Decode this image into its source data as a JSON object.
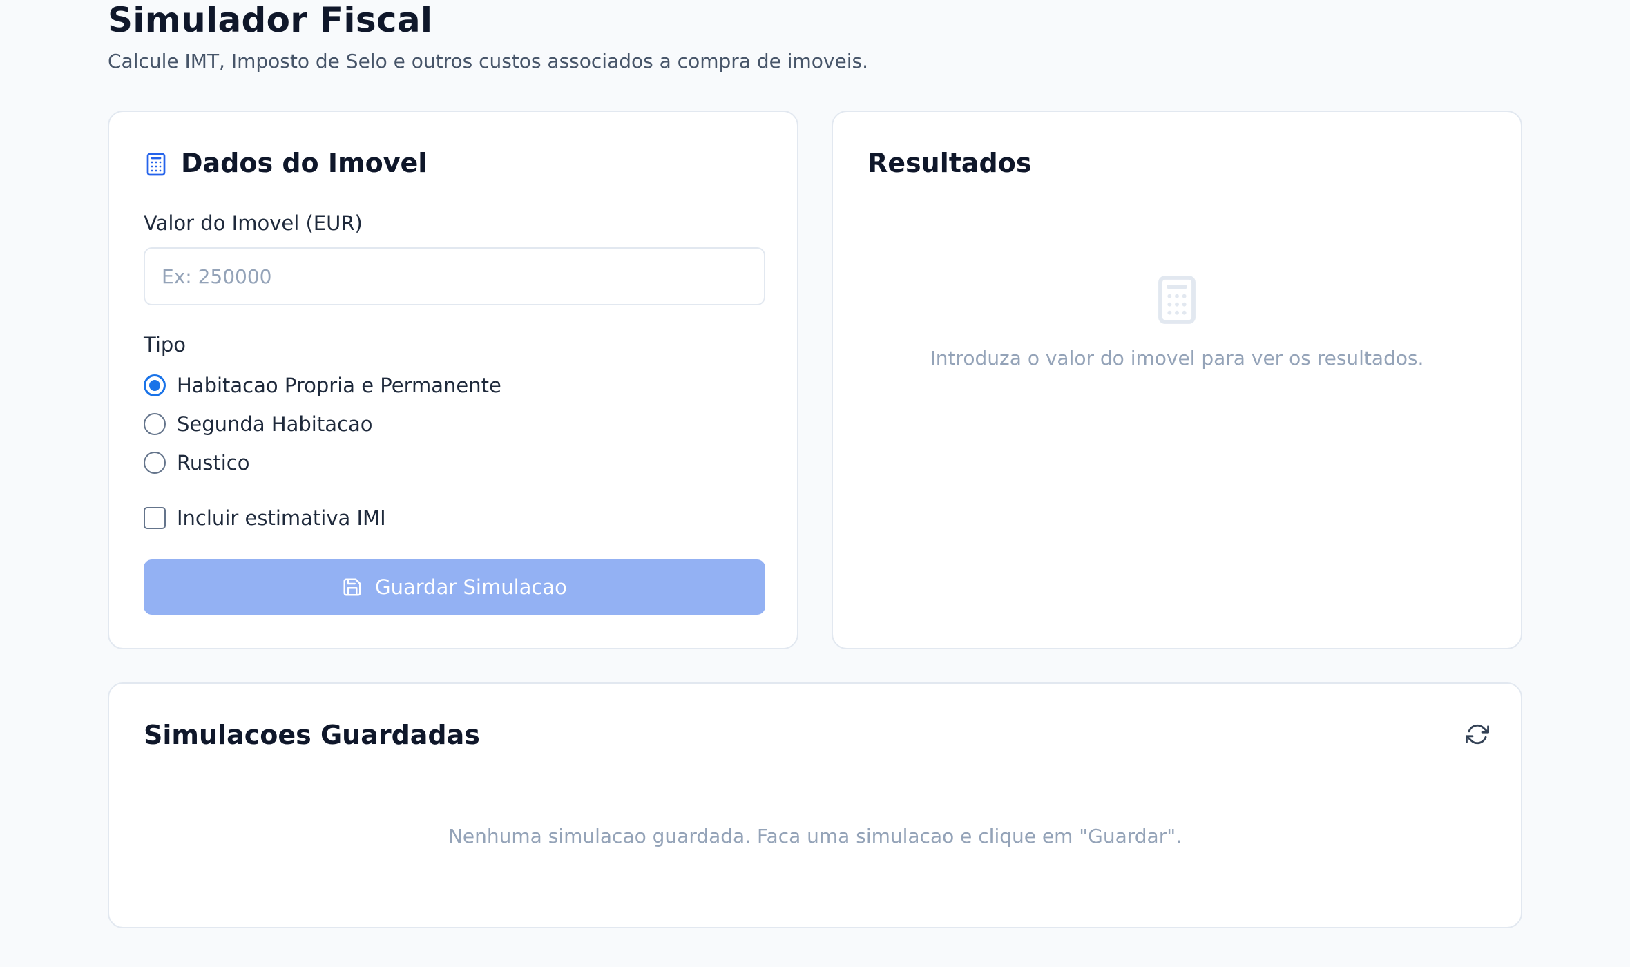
{
  "header": {
    "title": "Simulador Fiscal",
    "subtitle": "Calcule IMT, Imposto de Selo e outros custos associados a compra de imoveis."
  },
  "form": {
    "heading": "Dados do Imovel",
    "heading_icon": "calculator-icon",
    "value_label": "Valor do Imovel (EUR)",
    "value_input": "",
    "value_placeholder": "Ex: 250000",
    "type_label": "Tipo",
    "type_options": [
      {
        "label": "Habitacao Propria e Permanente",
        "selected": true
      },
      {
        "label": "Segunda Habitacao",
        "selected": false
      },
      {
        "label": "Rustico",
        "selected": false
      }
    ],
    "imi_checkbox_label": "Incluir estimativa IMI",
    "imi_checked": false,
    "save_button_label": "Guardar Simulacao",
    "save_button_icon": "save-icon",
    "save_button_disabled": true
  },
  "results": {
    "heading": "Resultados",
    "empty_icon": "calculator-icon",
    "empty_message": "Introduza o valor do imovel para ver os resultados."
  },
  "saved": {
    "heading": "Simulacoes Guardadas",
    "refresh_icon": "refresh-icon",
    "empty_message": "Nenhuma simulacao guardada. Faca uma simulacao e clique em \"Guardar\"."
  },
  "colors": {
    "background": "#f8fafc",
    "accent": "#1a73e8",
    "button_disabled": "#93b1f3",
    "muted_text": "#94a3b8",
    "card_border": "#e2e8f0"
  }
}
